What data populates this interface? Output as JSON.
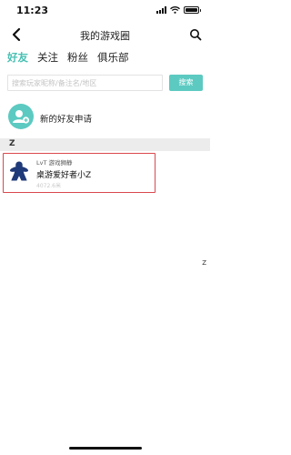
{
  "status_bar": {
    "time": "11:23"
  },
  "nav": {
    "title": "我的游戏圈"
  },
  "tabs": [
    {
      "label": "好友",
      "active": true
    },
    {
      "label": "关注",
      "active": false
    },
    {
      "label": "粉丝",
      "active": false
    },
    {
      "label": "俱乐部",
      "active": false
    }
  ],
  "search": {
    "placeholder": "搜索玩家昵称/备注名/地区",
    "button_label": "搜索"
  },
  "new_friend": {
    "label": "新的好友申请"
  },
  "section": {
    "letter": "Z"
  },
  "friend": {
    "group": "LvT 游戏狮静",
    "name": "桌游爱好者小Z",
    "sub": "4072.6米"
  },
  "alpha_index": "Z",
  "colors": {
    "accent": "#48c0b3",
    "button": "#5ccac1",
    "highlight": "#d9484d",
    "meeple": "#1f3a78"
  }
}
